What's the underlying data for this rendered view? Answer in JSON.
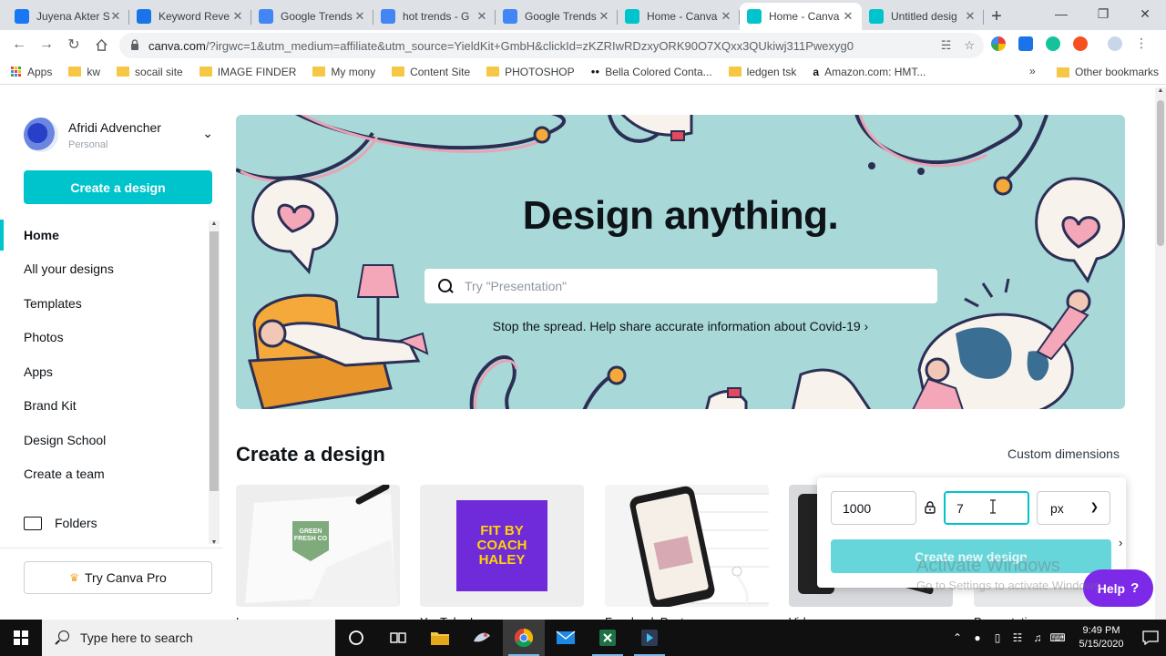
{
  "browser": {
    "tabs": [
      {
        "title": "Juyena Akter S",
        "favicon": "facebook-icon",
        "color": "#1877f2"
      },
      {
        "title": "Keyword Reve",
        "favicon": "keyword-revealer-icon",
        "color": "#1a73e8"
      },
      {
        "title": "Google Trends",
        "favicon": "google-trends-icon",
        "color": "#4285f4"
      },
      {
        "title": "hot trends - G",
        "favicon": "google-icon",
        "color": "#4285f4"
      },
      {
        "title": "Google Trends",
        "favicon": "google-icon",
        "color": "#4285f4"
      },
      {
        "title": "Home - Canva",
        "favicon": "canva-icon",
        "color": "#00c4cc"
      },
      {
        "title": "Home - Canva",
        "favicon": "canva-icon",
        "color": "#00c4cc",
        "active": true
      },
      {
        "title": "Untitled desig",
        "favicon": "canva-icon",
        "color": "#00c4cc"
      }
    ],
    "url_domain": "canva.com",
    "url_rest": "/?irgwc=1&utm_medium=affiliate&utm_source=YieldKit+GmbH&clickId=zKZRIwRDzxyORK90O7XQxx3QUkiwj311Pwexyg0",
    "bookmarks": [
      {
        "label": "Apps",
        "type": "apps"
      },
      {
        "label": "kw",
        "type": "folder"
      },
      {
        "label": "socail site",
        "type": "folder"
      },
      {
        "label": "IMAGE FINDER",
        "type": "folder"
      },
      {
        "label": "My mony",
        "type": "folder"
      },
      {
        "label": "Content Site",
        "type": "folder"
      },
      {
        "label": "PHOTOSHOP",
        "type": "folder"
      },
      {
        "label": "Bella Colored Conta...",
        "type": "site"
      },
      {
        "label": "ledgen tsk",
        "type": "folder"
      },
      {
        "label": "Amazon.com: HMT...",
        "type": "amazon"
      }
    ],
    "bookmarks_more": "»",
    "other_bookmarks": "Other bookmarks"
  },
  "sidebar": {
    "account_name": "Afridi Advencher",
    "account_type": "Personal",
    "create_label": "Create a design",
    "items": [
      {
        "label": "Home",
        "active": true
      },
      {
        "label": "All your designs"
      },
      {
        "label": "Templates"
      },
      {
        "label": "Photos"
      },
      {
        "label": "Apps"
      },
      {
        "label": "Brand Kit"
      },
      {
        "label": "Design School"
      },
      {
        "label": "Create a team"
      }
    ],
    "folders_label": "Folders",
    "pro_label": "Try Canva Pro"
  },
  "hero": {
    "title": "Design anything.",
    "search_placeholder": "Try \"Presentation\"",
    "covid_text": "Stop the spread. Help share accurate information about Covid-19 ›",
    "bg_color": "#a8d8d8"
  },
  "create": {
    "title": "Create a design",
    "custom_label": "Custom dimensions",
    "cards": [
      {
        "label": "Logo"
      },
      {
        "label": "YouTube Icon"
      },
      {
        "label": "Facebook Post"
      },
      {
        "label": "Video"
      },
      {
        "label": "Presentation"
      }
    ],
    "youtube_card_text": [
      "FIT BY",
      "COACH",
      "HALEY"
    ],
    "logo_card_text": [
      "GREEN",
      "FRESH CO"
    ]
  },
  "custom_dimensions": {
    "width": "1000",
    "height": "7",
    "unit": "px",
    "create_label": "Create new design"
  },
  "watermark": {
    "line1": "Activate Windows",
    "line2": "Go to Settings to activate Windows."
  },
  "help": {
    "label": "Help",
    "icon": "?"
  },
  "taskbar": {
    "search_placeholder": "Type here to search",
    "time": "9:49 PM",
    "date": "5/15/2020"
  }
}
